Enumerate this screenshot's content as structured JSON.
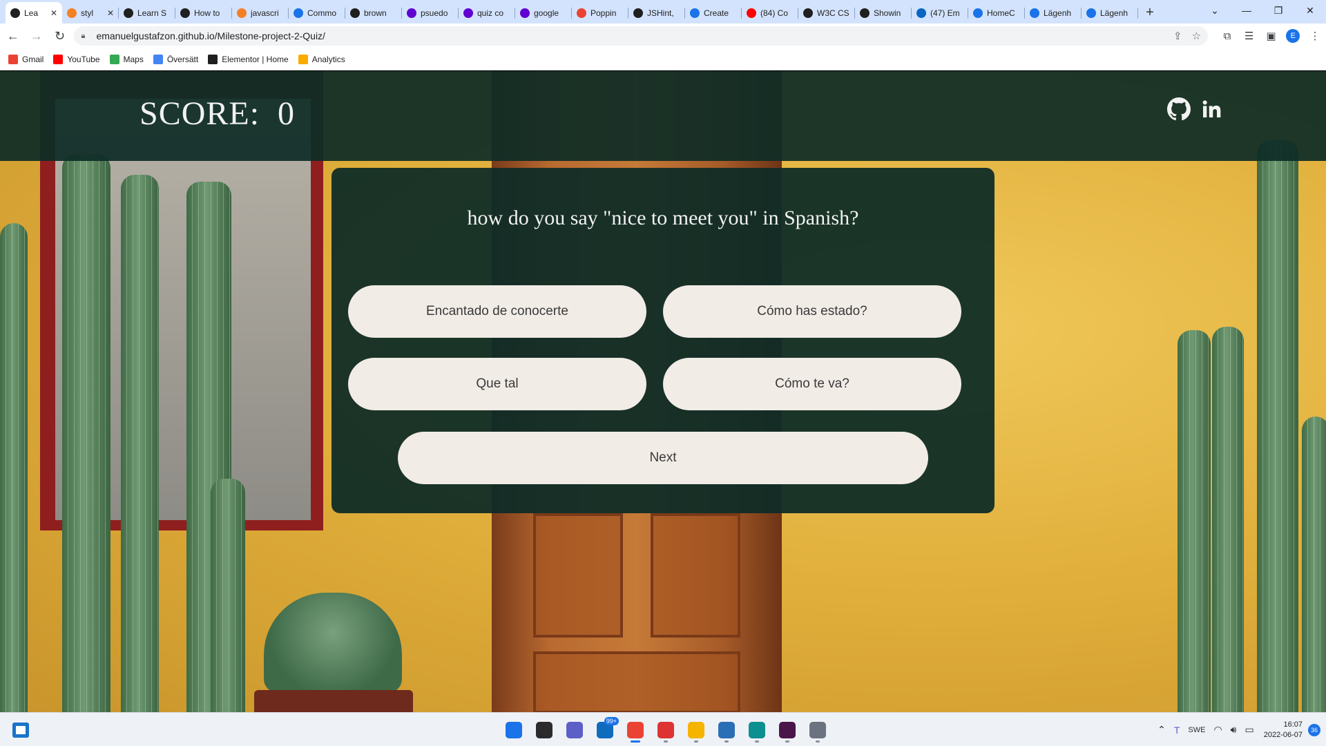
{
  "browser": {
    "tabs": [
      {
        "label": "Lea",
        "favicon": "github-icon",
        "color": "#1f1f1f",
        "active": true
      },
      {
        "label": "styl",
        "favicon": "stack-icon",
        "color": "#f48024",
        "closable": true
      },
      {
        "label": "Learn S",
        "favicon": "github-icon",
        "color": "#1f1f1f"
      },
      {
        "label": "How to",
        "favicon": "github-icon",
        "color": "#1f1f1f"
      },
      {
        "label": "javascri",
        "favicon": "stack-icon",
        "color": "#f48024"
      },
      {
        "label": "Commo",
        "favicon": "chat-icon",
        "color": "#1a73e8"
      },
      {
        "label": "brown",
        "favicon": "puzzle-icon",
        "color": "#1f1f1f"
      },
      {
        "label": "psuedo",
        "favicon": "yahoo-icon",
        "color": "#6001d2"
      },
      {
        "label": "quiz co",
        "favicon": "yahoo-icon",
        "color": "#6001d2"
      },
      {
        "label": "google",
        "favicon": "yahoo-icon",
        "color": "#6001d2"
      },
      {
        "label": "Poppin",
        "favicon": "google-fonts-icon",
        "color": "#ea4335"
      },
      {
        "label": "JSHint,",
        "favicon": "github-icon",
        "color": "#1f1f1f"
      },
      {
        "label": "Create",
        "favicon": "c-icon",
        "color": "#1a73e8"
      },
      {
        "label": "(84) Co",
        "favicon": "youtube-icon",
        "color": "#ff0000"
      },
      {
        "label": "W3C CS",
        "favicon": "w3c-icon",
        "color": "#1f1f1f"
      },
      {
        "label": "Showin",
        "favicon": "m-icon",
        "color": "#1f1f1f"
      },
      {
        "label": "(47) Em",
        "favicon": "linkedin-icon",
        "color": "#0a66c2"
      },
      {
        "label": "HomeC",
        "favicon": "q-icon",
        "color": "#1a73e8"
      },
      {
        "label": "Lägenh",
        "favicon": "q-icon",
        "color": "#1a73e8"
      },
      {
        "label": "Lägenh",
        "favicon": "q-icon",
        "color": "#1a73e8"
      }
    ],
    "new_tab_label": "+",
    "url": "emanuelgustafzon.github.io/Milestone-project-2-Quiz/",
    "profile_initial": "E",
    "bookmarks": [
      {
        "label": "Gmail",
        "icon": "gmail-icon",
        "color": "#ea4335"
      },
      {
        "label": "YouTube",
        "icon": "youtube-icon",
        "color": "#ff0000"
      },
      {
        "label": "Maps",
        "icon": "maps-icon",
        "color": "#34a853"
      },
      {
        "label": "Översätt",
        "icon": "translate-icon",
        "color": "#4285f4"
      },
      {
        "label": "Elementor | Home",
        "icon": "wordpress-icon",
        "color": "#1f1f1f"
      },
      {
        "label": "Analytics",
        "icon": "analytics-icon",
        "color": "#f9ab00"
      }
    ]
  },
  "page": {
    "score_label": "SCORE:",
    "score_value": "0",
    "question": "how do you say \"nice to meet you\" in Spanish?",
    "answers": [
      "Encantado de conocerte",
      "Cómo has estado?",
      "Que tal",
      "Cómo te va?"
    ],
    "next_label": "Next",
    "header_color": "#0e2c26",
    "button_color": "#f1ece6"
  },
  "taskbar": {
    "apps": [
      {
        "name": "start-icon",
        "color": "#1a73e8"
      },
      {
        "name": "search-icon",
        "color": "#2b2b2b"
      },
      {
        "name": "teams-chat-icon",
        "color": "#5b5fc7"
      },
      {
        "name": "mail-icon",
        "color": "#0f6cbd",
        "badge": "99+"
      },
      {
        "name": "chrome-icon",
        "color": "#ea4335",
        "active": true
      },
      {
        "name": "gift-icon",
        "color": "#d33"
      },
      {
        "name": "file-explorer-icon",
        "color": "#f4b400"
      },
      {
        "name": "photos-icon",
        "color": "#2a6fb5"
      },
      {
        "name": "edge-icon",
        "color": "#0c8f8f"
      },
      {
        "name": "slack-icon",
        "color": "#4a154b"
      },
      {
        "name": "settings-icon",
        "color": "#6b7280"
      }
    ],
    "language": "SWE",
    "time": "16:07",
    "date": "2022-06-07",
    "notifications": "36"
  }
}
